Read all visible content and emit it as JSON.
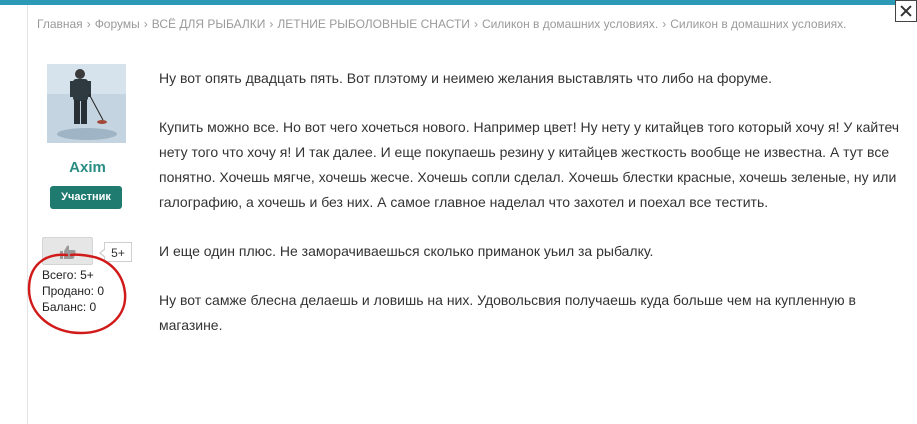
{
  "breadcrumb": {
    "items": [
      "Главная",
      "Форумы",
      "ВСЁ ДЛЯ РЫБАЛКИ",
      "ЛЕТНИЕ РЫБОЛОВНЫЕ СНАСТИ",
      "Силикон в домашних условиях.",
      "Силикон в домашних условиях."
    ],
    "separator": "›"
  },
  "author": {
    "name": "Axim",
    "role": "Участник"
  },
  "reputation": {
    "badge": "5+",
    "total": "Всего: 5+",
    "sold": "Продано: 0",
    "balance": "Баланс: 0"
  },
  "post": {
    "paragraphs": [
      "Ну вот опять двадцать пять. Вот плэтому и неимею желания выставлять что либо на форуме.",
      "Купить можно все. Но вот чего хочеться нового. Например цвет! Ну нету у китайцев того который хочу я! У кайтеч нету того что хочу я! И так далее. И еще покупаешь резину у китайцев жесткость вообще не известна. А тут все понятно. Хочешь мягче, хочешь жесче. Хочешь сопли сделал. Хочешь блестки красные, хочешь зеленые, ну или галографию, а хочешь и без них. А самое главное наделал что захотел и поехал все тестить.",
      "И еще один плюс. Не заморачиваешься сколько приманок уьил за рыбалку.",
      "Ну вот самже блесна делаешь и ловишь на них. Удовольсвия получаешь куда больше чем на купленную в магазине."
    ]
  },
  "colors": {
    "accent": "#2a8d82",
    "badge_bg": "#1f7a70",
    "annotation": "#d11a1a",
    "topbar": "#2a9ab7"
  },
  "icons": {
    "like": "thumbs-up-icon",
    "close": "close-icon"
  }
}
